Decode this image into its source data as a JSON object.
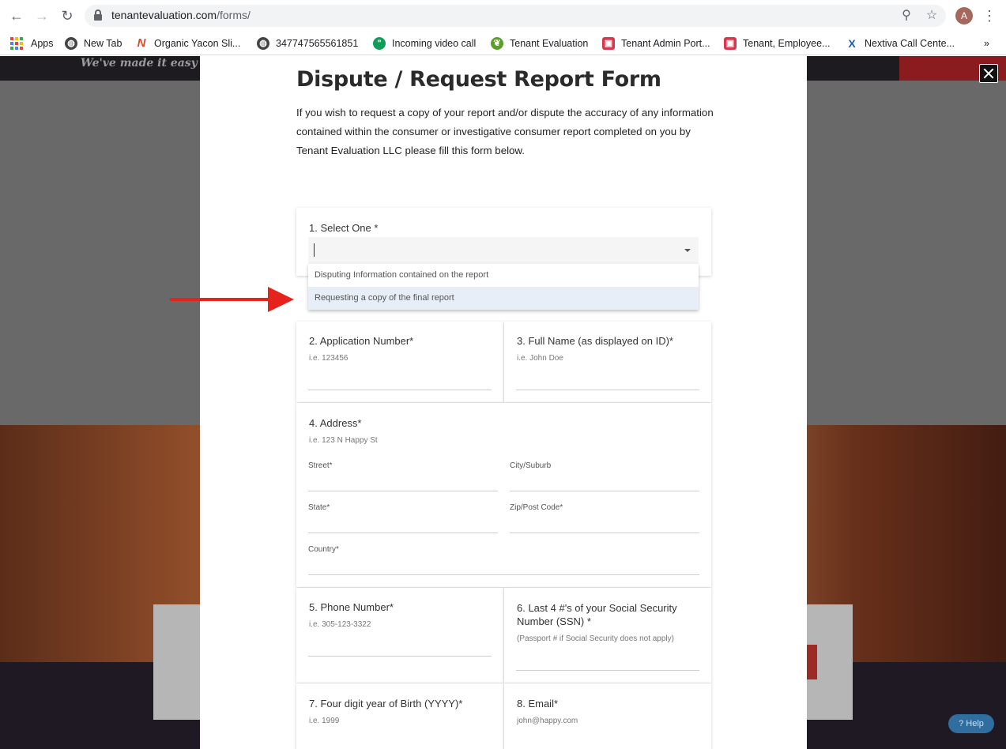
{
  "browser": {
    "url_host": "tenantevaluation.com",
    "url_path": "/forms/",
    "profile_initial": "A",
    "bookmarks": [
      {
        "label": "Apps",
        "icon": "apps-grid-icon"
      },
      {
        "label": "New Tab",
        "icon": "globe-icon"
      },
      {
        "label": "Organic Yacon Sli...",
        "icon": "n-logo-icon"
      },
      {
        "label": "347747565561851",
        "icon": "globe-icon"
      },
      {
        "label": "Incoming video call",
        "icon": "hangouts-icon"
      },
      {
        "label": "Tenant Evaluation",
        "icon": "leaf-logo-icon"
      },
      {
        "label": "Tenant Admin Port...",
        "icon": "gift-logo-icon"
      },
      {
        "label": "Tenant, Employee...",
        "icon": "gift-logo-icon"
      },
      {
        "label": "Nextiva Call Cente...",
        "icon": "nextiva-icon"
      }
    ],
    "more_label": "»"
  },
  "site": {
    "tagline": "We've made it easy",
    "help_label": "Help"
  },
  "form": {
    "title": "Dispute / Request Report Form",
    "intro": "If you wish to request a copy of your report and/or dispute the accuracy of any information contained within the consumer or investigative consumer report completed on you by Tenant Evaluation LLC please fill this form below.",
    "select": {
      "label": "1. Select One *",
      "options": [
        "Disputing Information contained on the report",
        "Requesting a copy of the final report"
      ],
      "highlighted_index": 1
    },
    "app_number": {
      "label": "2. Application Number*",
      "hint": "i.e. 123456"
    },
    "full_name": {
      "label": "3. Full Name (as displayed on ID)*",
      "hint": "i.e. John Doe"
    },
    "address": {
      "label": "4. Address*",
      "hint": "i.e. 123 N Happy St",
      "street": "Street*",
      "city": "City/Suburb",
      "state": "State*",
      "zip": "Zip/Post Code*",
      "country": "Country*"
    },
    "phone": {
      "label": "5. Phone Number*",
      "hint": "i.e. 305-123-3322"
    },
    "ssn": {
      "label": "6. Last 4 #'s of your Social Security Number (SSN) *",
      "hint": "(Passport # if Social Security does not apply)"
    },
    "birth_year": {
      "label": "7. Four digit year of Birth (YYYY)*",
      "hint": "i.e. 1999"
    },
    "email": {
      "label": "8. Email*",
      "hint": "john@happy.com"
    }
  },
  "colors": {
    "annotation_arrow": "#e5221b",
    "header_red": "#b8262b",
    "dropdown_highlight": "#e8eef8"
  }
}
